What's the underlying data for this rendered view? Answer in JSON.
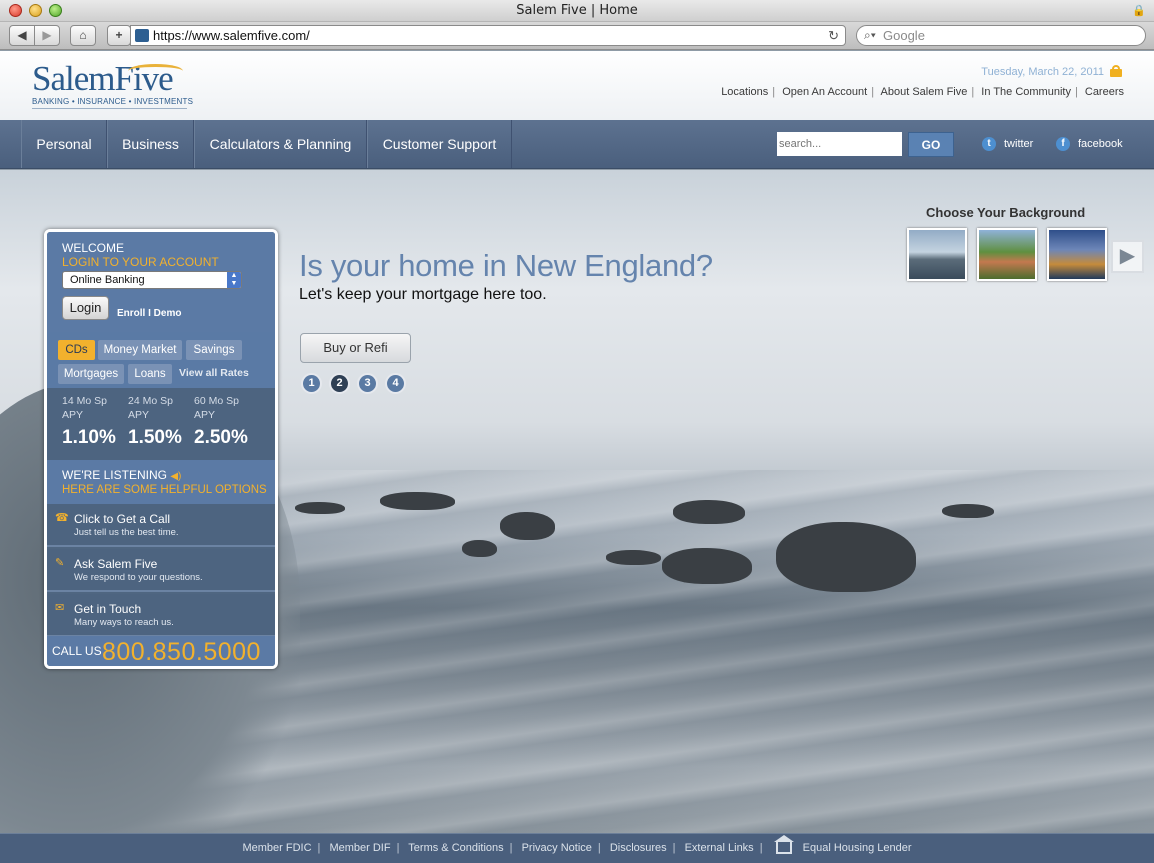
{
  "browser": {
    "window_title": "Salem Five | Home",
    "url": "https://www.salemfive.com/",
    "search_placeholder": "Google"
  },
  "header": {
    "logo_word": "SalemFive",
    "logo_tagline": "BANKING • INSURANCE • INVESTMENTS",
    "date": "Tuesday, March 22, 2011",
    "links": [
      "Locations",
      "Open An Account",
      "About Salem Five",
      "In The Community",
      "Careers"
    ]
  },
  "nav": {
    "items": [
      "Personal",
      "Business",
      "Calculators & Planning",
      "Customer Support"
    ],
    "search_placeholder": "search...",
    "go_label": "GO",
    "twitter_label": "twitter",
    "facebook_label": "facebook"
  },
  "hero": {
    "choose_title": "Choose Your Background",
    "headline": "Is your home in New England?",
    "subhead": "Let's keep your mortgage here too.",
    "cta_label": "Buy or Refi",
    "slides": [
      "1",
      "2",
      "3",
      "4"
    ],
    "active_slide": "2"
  },
  "panel": {
    "welcome": "WELCOME",
    "login_heading": "LOGIN TO YOUR ACCOUNT",
    "account_type": "Online Banking",
    "login_label": "Login",
    "enroll_demo": "Enroll I Demo",
    "rate_tabs": [
      "CDs",
      "Money Market",
      "Savings",
      "Mortgages",
      "Loans"
    ],
    "view_all": "View all Rates",
    "rates": [
      {
        "term": "14 Mo Sp",
        "apy": "APY",
        "value": "1.10%"
      },
      {
        "term": "24 Mo Sp",
        "apy": "APY",
        "value": "1.50%"
      },
      {
        "term": "60 Mo Sp",
        "apy": "APY",
        "value": "2.50%"
      }
    ],
    "listening_title": "WE'RE LISTENING",
    "listening_sub": "HERE ARE SOME HELPFUL OPTIONS",
    "help": [
      {
        "title": "Click to Get a Call",
        "sub": "Just tell us the best time."
      },
      {
        "title": "Ask Salem Five",
        "sub": "We respond to your questions."
      },
      {
        "title": "Get in Touch",
        "sub": "Many ways to reach us."
      }
    ],
    "call_label": "CALL US",
    "call_number": "800.850.5000"
  },
  "footer": {
    "links": [
      "Member FDIC",
      "Member DIF",
      "Terms & Conditions",
      "Privacy Notice",
      "Disclosures",
      "External Links"
    ],
    "equal_housing": "Equal Housing Lender"
  },
  "colors": {
    "brand_blue": "#4a5f7d",
    "accent_gold": "#f2b12d",
    "headline_blue": "#6584ad"
  }
}
